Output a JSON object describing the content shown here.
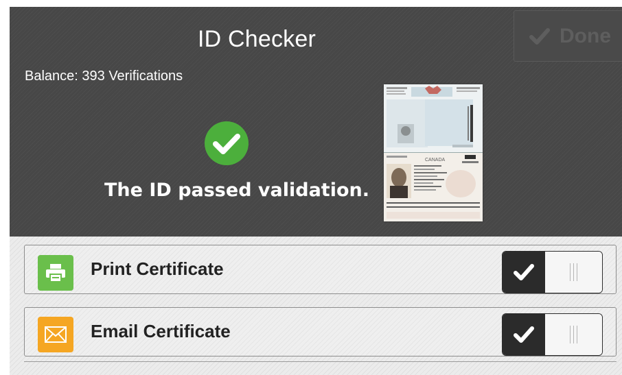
{
  "header": {
    "title": "ID Checker",
    "done_label": "Done",
    "balance": "Balance: 393 Verifications",
    "status_message": "The ID passed validation.",
    "status_color": "#4caf3c"
  },
  "document_preview": {
    "issuer_text": "CANADA"
  },
  "options": [
    {
      "label": "Print Certificate",
      "icon": "printer-icon",
      "icon_color": "#6abf4b",
      "enabled": true
    },
    {
      "label": "Email Certificate",
      "icon": "envelope-icon",
      "icon_color": "#f5a623",
      "enabled": true
    }
  ]
}
